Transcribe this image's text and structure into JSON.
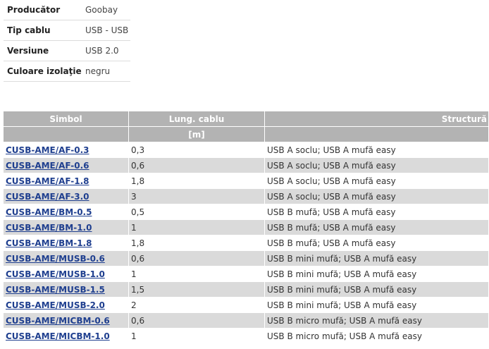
{
  "specs": [
    {
      "label": "Producător",
      "value": "Goobay"
    },
    {
      "label": "Tip cablu",
      "value": "USB - USB"
    },
    {
      "label": "Versiune",
      "value": "USB 2.0"
    },
    {
      "label": "Culoare izolaţie",
      "value": "negru"
    }
  ],
  "table": {
    "headers": {
      "simbol": "Simbol",
      "lung": "Lung. cablu",
      "lung_unit": "[m]",
      "structura": "Structură"
    },
    "rows": [
      {
        "simbol": "CUSB-AME/AF-0.3",
        "lung": "0,3",
        "structura": "USB A soclu; USB A mufă easy"
      },
      {
        "simbol": "CUSB-AME/AF-0.6",
        "lung": "0,6",
        "structura": "USB A soclu; USB A mufă easy"
      },
      {
        "simbol": "CUSB-AME/AF-1.8",
        "lung": "1,8",
        "structura": "USB A soclu; USB A mufă easy"
      },
      {
        "simbol": "CUSB-AME/AF-3.0",
        "lung": "3",
        "structura": "USB A soclu; USB A mufă easy"
      },
      {
        "simbol": "CUSB-AME/BM-0.5",
        "lung": "0,5",
        "structura": "USB B mufă; USB A mufă easy"
      },
      {
        "simbol": "CUSB-AME/BM-1.0",
        "lung": "1",
        "structura": "USB B mufă; USB A mufă easy"
      },
      {
        "simbol": "CUSB-AME/BM-1.8",
        "lung": "1,8",
        "structura": "USB B mufă; USB A mufă easy"
      },
      {
        "simbol": "CUSB-AME/MUSB-0.6",
        "lung": "0,6",
        "structura": "USB B mini mufă; USB A mufă easy"
      },
      {
        "simbol": "CUSB-AME/MUSB-1.0",
        "lung": "1",
        "structura": "USB B mini mufă; USB A mufă easy"
      },
      {
        "simbol": "CUSB-AME/MUSB-1.5",
        "lung": "1,5",
        "structura": "USB B mini mufă; USB A mufă easy"
      },
      {
        "simbol": "CUSB-AME/MUSB-2.0",
        "lung": "2",
        "structura": "USB B mini mufă; USB A mufă easy"
      },
      {
        "simbol": "CUSB-AME/MICBM-0.6",
        "lung": "0,6",
        "structura": "USB B micro mufă; USB A mufă easy"
      },
      {
        "simbol": "CUSB-AME/MICBM-1.0",
        "lung": "1",
        "structura": "USB B micro mufă; USB A mufă easy"
      }
    ]
  }
}
